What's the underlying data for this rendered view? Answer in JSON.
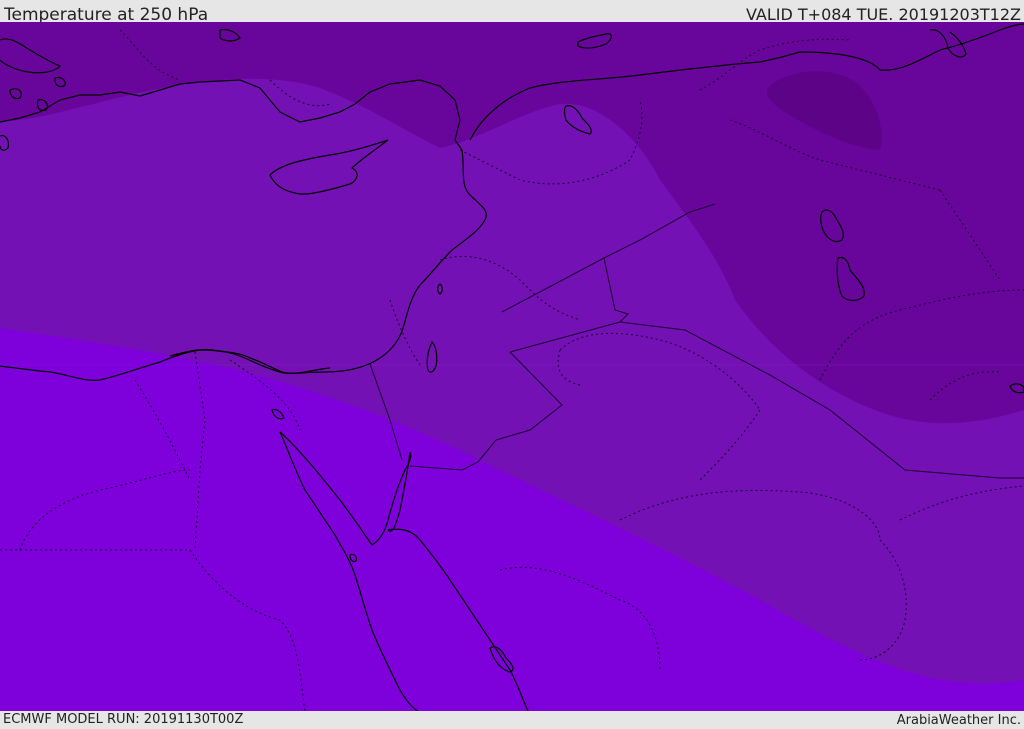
{
  "header": {
    "title": "Temperature at 250 hPa",
    "valid": "VALID T+084 TUE. 20191203T12Z"
  },
  "footer": {
    "model_run": "ECMWF MODEL RUN: 20191130T00Z",
    "credit": "ArabiaWeather Inc."
  },
  "colors": {
    "band_warmest": "#7e00db",
    "band_mid": "#7411b5",
    "band_cool": "#68069c",
    "band_coldest": "#5c0388",
    "coastline": "#000000",
    "borders": "#1a0030"
  }
}
